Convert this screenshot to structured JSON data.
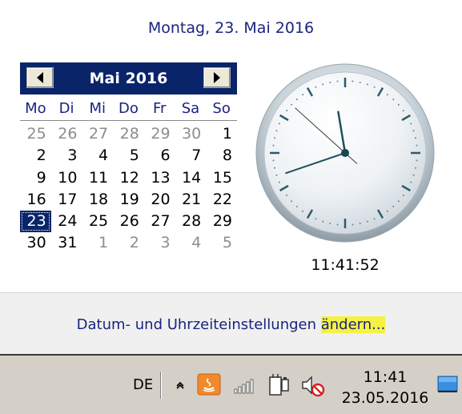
{
  "long_date": "Montag, 23. Mai 2016",
  "calendar": {
    "title": "Mai 2016",
    "weekdays": [
      "Mo",
      "Di",
      "Mi",
      "Do",
      "Fr",
      "Sa",
      "So"
    ],
    "days": [
      {
        "d": "25",
        "muted": true
      },
      {
        "d": "26",
        "muted": true
      },
      {
        "d": "27",
        "muted": true
      },
      {
        "d": "28",
        "muted": true
      },
      {
        "d": "29",
        "muted": true
      },
      {
        "d": "30",
        "muted": true
      },
      {
        "d": "1"
      },
      {
        "d": "2"
      },
      {
        "d": "3"
      },
      {
        "d": "4"
      },
      {
        "d": "5"
      },
      {
        "d": "6"
      },
      {
        "d": "7"
      },
      {
        "d": "8"
      },
      {
        "d": "9"
      },
      {
        "d": "10"
      },
      {
        "d": "11"
      },
      {
        "d": "12"
      },
      {
        "d": "13"
      },
      {
        "d": "14"
      },
      {
        "d": "15"
      },
      {
        "d": "16"
      },
      {
        "d": "17"
      },
      {
        "d": "18"
      },
      {
        "d": "19"
      },
      {
        "d": "20"
      },
      {
        "d": "21"
      },
      {
        "d": "22"
      },
      {
        "d": "23",
        "today": true
      },
      {
        "d": "24"
      },
      {
        "d": "25"
      },
      {
        "d": "26"
      },
      {
        "d": "27"
      },
      {
        "d": "28"
      },
      {
        "d": "29"
      },
      {
        "d": "30"
      },
      {
        "d": "31"
      },
      {
        "d": "1",
        "muted": true
      },
      {
        "d": "2",
        "muted": true
      },
      {
        "d": "3",
        "muted": true
      },
      {
        "d": "4",
        "muted": true
      },
      {
        "d": "5",
        "muted": true
      }
    ]
  },
  "clock": {
    "time": "11:41:52",
    "hours": 11,
    "minutes": 41,
    "seconds": 52
  },
  "settings": {
    "link_prefix": "Datum- und Uhrzeiteinstellungen ",
    "link_highlight": "ändern..."
  },
  "taskbar": {
    "language": "DE",
    "time": "11:41",
    "date": "23.05.2016",
    "icons": [
      "show-hidden-chevron-icon",
      "java-icon",
      "network-signal-icon",
      "power-plug-icon",
      "speaker-muted-icon",
      "show-desktop-icon"
    ]
  },
  "colors": {
    "header_navy": "#0a246a",
    "link_blue": "#1a237e",
    "highlight_yellow": "#f5f242"
  }
}
